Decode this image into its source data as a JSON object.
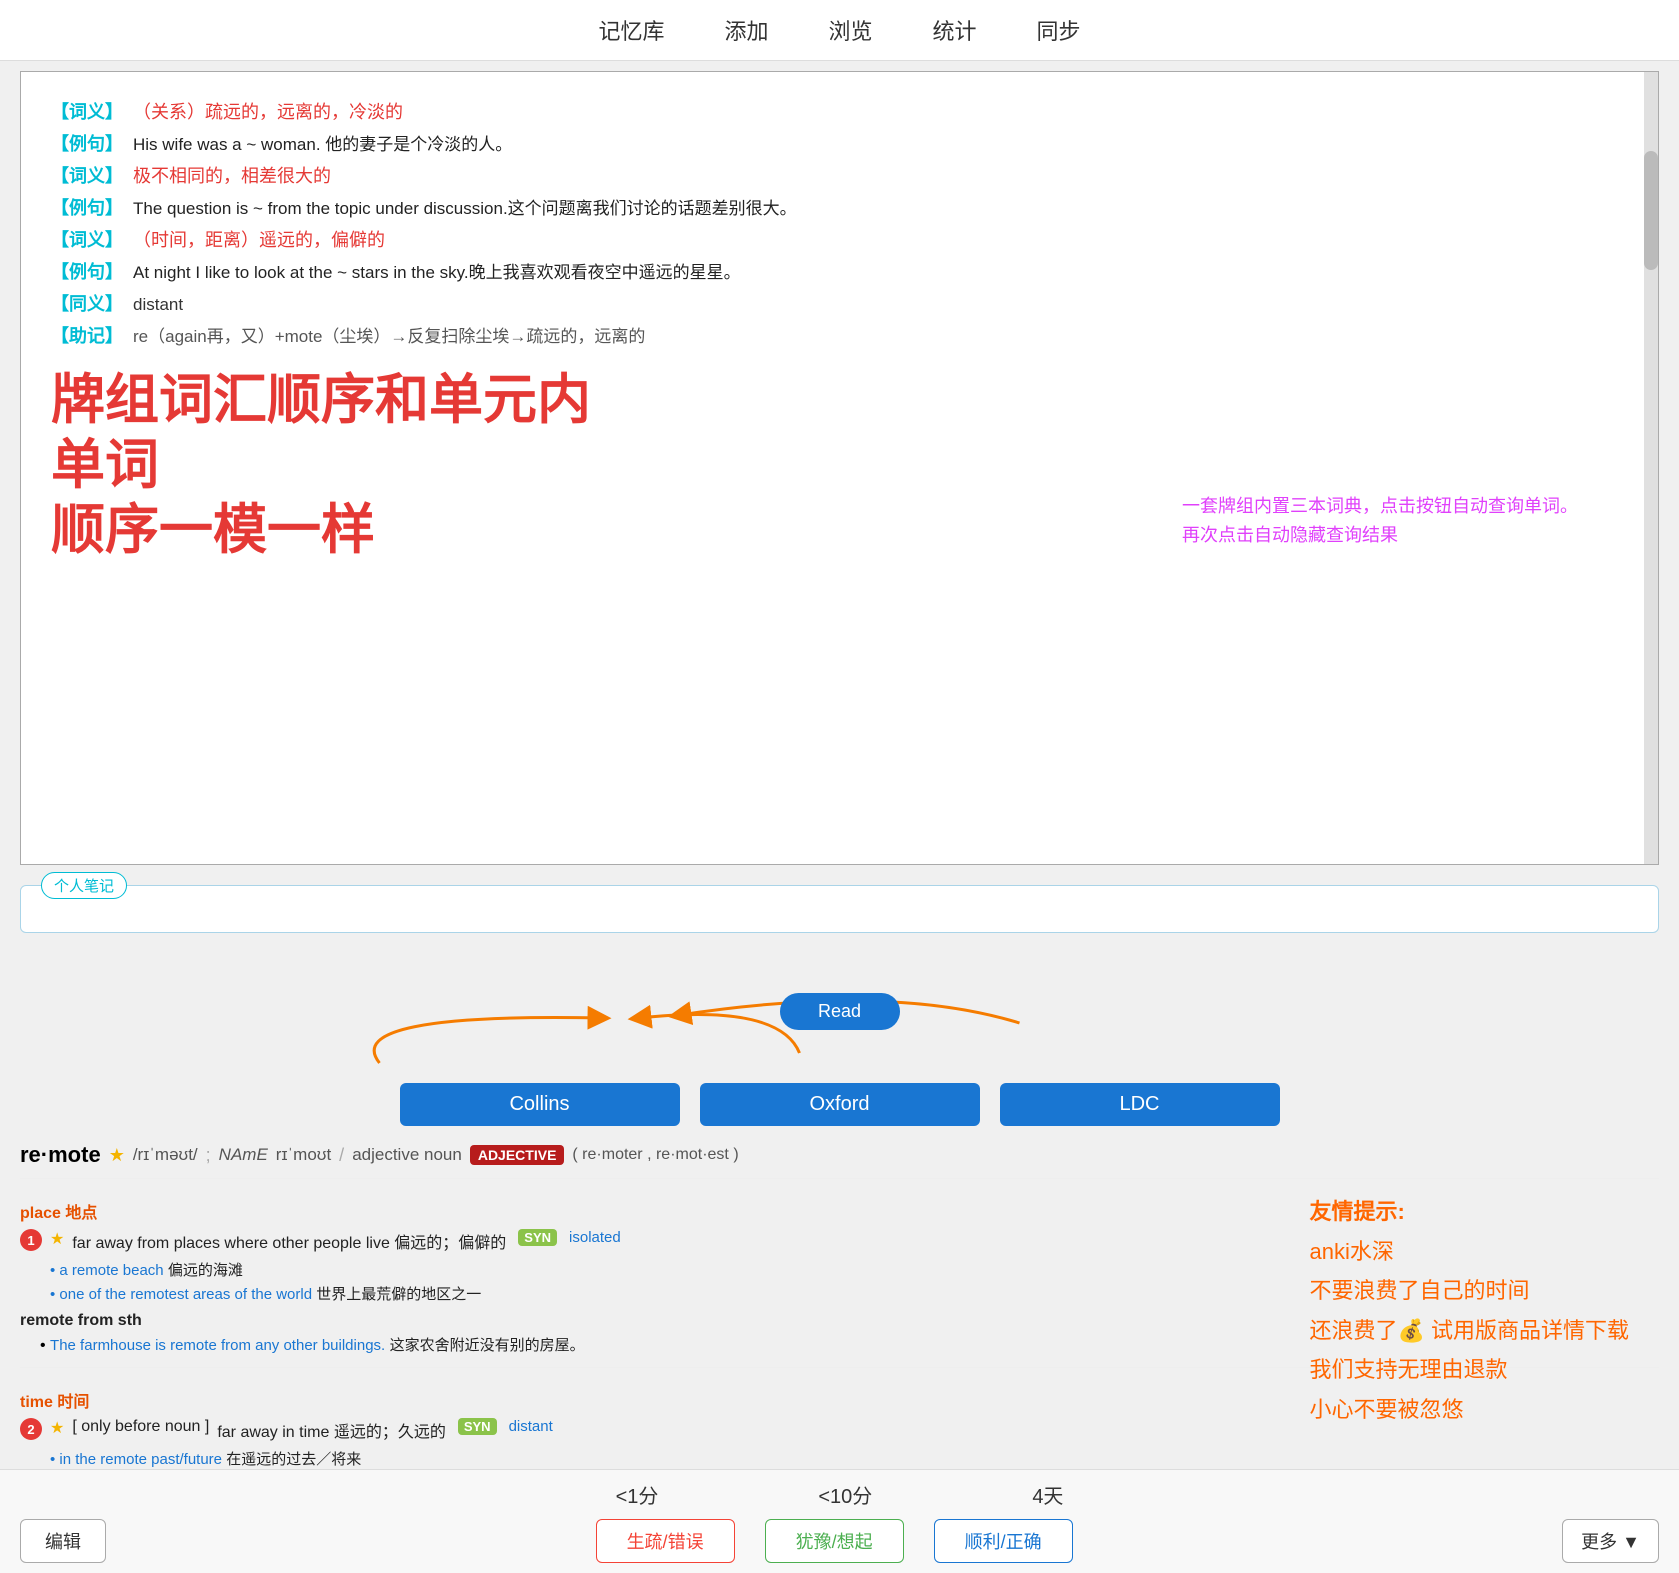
{
  "nav": {
    "items": [
      "记忆库",
      "添加",
      "浏览",
      "统计",
      "同步"
    ]
  },
  "dict_content": {
    "entries": [
      {
        "label": "【词义】",
        "label_type": "cyan",
        "text": "（关系）疏远的，远离的，冷淡的",
        "text_type": "red"
      },
      {
        "label": "【例句】",
        "label_type": "cyan",
        "text": "His wife was a ~ woman. 他的妻子是个冷淡的人。"
      },
      {
        "label": "【词义】",
        "label_type": "cyan",
        "text": "极不相同的，相差很大的",
        "text_type": "red"
      },
      {
        "label": "【例句】",
        "label_type": "cyan",
        "text": "The question is ~ from the topic under discussion.这个问题离我们讨论的话题差别很大。"
      },
      {
        "label": "【词义】",
        "label_type": "cyan",
        "text": "（时间，距离）遥远的，偏僻的",
        "text_type": "red"
      },
      {
        "label": "【例句】",
        "label_type": "cyan",
        "text": "At night I like to look at the ~ stars in the sky.晚上我喜欢观看夜空中遥远的星星。"
      },
      {
        "label": "【同义】",
        "label_type": "cyan",
        "text": "distant"
      }
    ],
    "memory_tip": {
      "label": "【助记】",
      "text": "re（again再，又）+mote（尘埃）→反复扫除尘埃→疏远的，远离的"
    }
  },
  "promo": {
    "line1": "牌组词汇顺序和单元内",
    "line2": "单词",
    "line3": "顺序一模一样"
  },
  "promo_hint": {
    "line1": "一套牌组内置三本词典，点击按钮自动查询单词。",
    "line2": "再次点击自动隐藏查询结果"
  },
  "notes": {
    "label": "个人笔记",
    "placeholder": ""
  },
  "dict_buttons": {
    "read_label": "Read",
    "collins_label": "Collins",
    "oxford_label": "Oxford",
    "ldc_label": "LDC"
  },
  "word": {
    "text": "re·mote",
    "star": "★",
    "phonetic_br": "/rɪˈməʊt/",
    "phonetic_sep": ";",
    "name_label": "NAmE",
    "phonetic_am": "rɪˈmoʊt",
    "sep2": "/",
    "pos": "adjective noun",
    "pos_badge": "ADJECTIVE",
    "inflection": "( re·moter , re·mot·est )"
  },
  "place_section": {
    "label": "place 地点",
    "defs": [
      {
        "num": "1",
        "star": "★",
        "text": "far away from places where other people live 偏远的；偏僻的",
        "syn_label": "SYN",
        "syn_word": "isolated",
        "examples": [
          "a remote beach 偏远的海滩",
          "one of the remotest areas of the world 世界上最荒僻的地区之一"
        ]
      }
    ],
    "phrase": {
      "label": "remote from sth",
      "example": "The farmhouse is remote from any other buildings.",
      "cn": "这家农舍附近没有别的房屋。"
    }
  },
  "time_section": {
    "label": "time 时间",
    "defs": [
      {
        "num": "2",
        "star": "★",
        "qualifier": "[only before noun ]",
        "text": "far away in time 遥远的；久远的",
        "syn_label": "SYN",
        "syn_word": "distant",
        "example": "in the remote past/future 在遥远的过去／将来"
      }
    ]
  },
  "warning": {
    "title": "友情提示:",
    "lines": [
      "anki水深",
      "不要浪费了自己的时间",
      "还浪费了💰 试用版商品详情下载",
      "我们支持无理由退款",
      "小心不要被忽悠"
    ]
  },
  "bottom": {
    "times": [
      "<1分",
      "<10分",
      "4天"
    ],
    "edit_label": "编辑",
    "btn1": "生疏/错误",
    "btn2": "犹豫/想起",
    "btn3": "顺利/正确",
    "more_label": "更多 ▼"
  }
}
